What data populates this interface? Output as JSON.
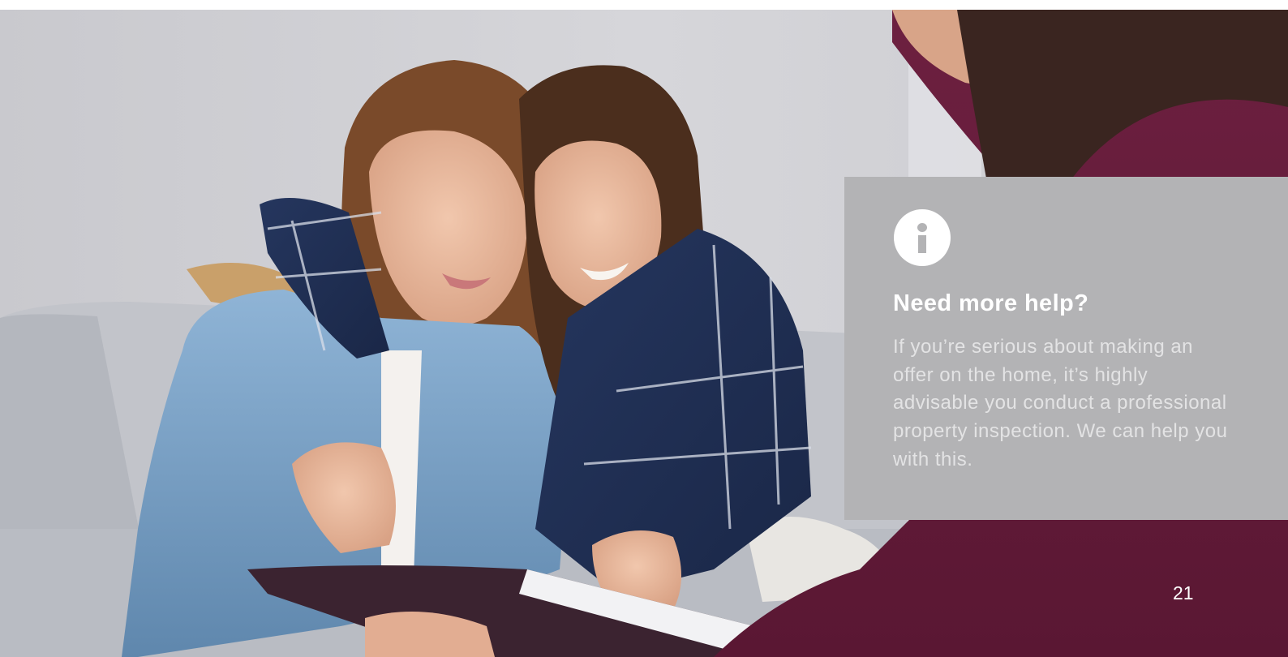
{
  "photo": {
    "icon": "couple-reviewing-documents-photo"
  },
  "info_box": {
    "icon": "info-icon",
    "heading": "Need more help?",
    "body": "If you’re serious about making an offer on the home, it’s highly advisable you conduct a professional property inspection. We can help you with this."
  },
  "page_number": "21",
  "colors": {
    "panel": "#b3b3b5",
    "text": "#ffffff",
    "wall": "#cfcfd3",
    "sofa": "#c3c5ca",
    "agent_top": "#6b1e3c"
  }
}
